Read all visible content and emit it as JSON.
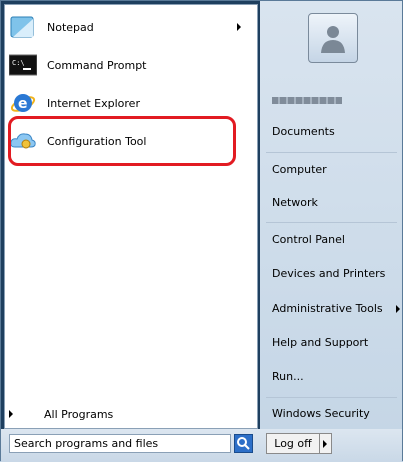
{
  "left": {
    "pinned": [
      {
        "label": "Notepad",
        "icon": "notepad-icon",
        "has_submenu": true
      },
      {
        "label": "Command Prompt",
        "icon": "command-prompt-icon",
        "has_submenu": false
      },
      {
        "label": "Internet Explorer",
        "icon": "internet-explorer-icon",
        "has_submenu": false
      },
      {
        "label": "Configuration Tool",
        "icon": "cloud-config-icon",
        "has_submenu": false
      }
    ],
    "all_programs": "All Programs",
    "search_placeholder": "Search programs and files"
  },
  "right": {
    "items": [
      "Documents",
      "Computer",
      "Network",
      "Control Panel",
      "Devices and Printers",
      "Administrative Tools",
      "Help and Support",
      "Run...",
      "Windows Security"
    ],
    "logoff": "Log off"
  },
  "colors": {
    "highlight": "#e21b22"
  }
}
